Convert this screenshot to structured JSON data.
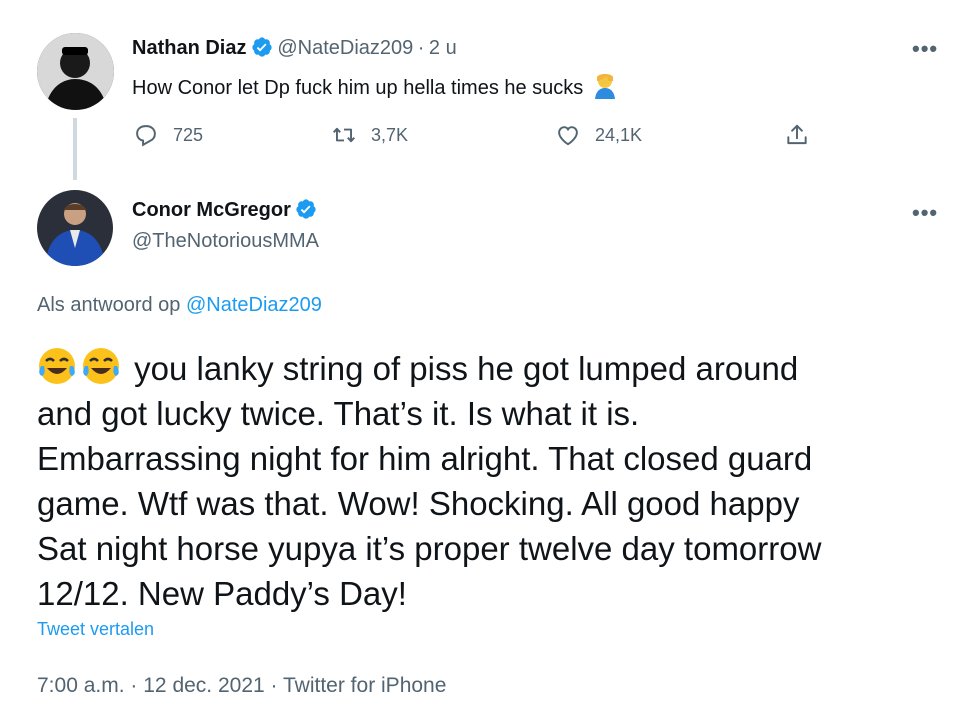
{
  "tweet1": {
    "name": "Nathan Diaz",
    "handle": "@NateDiaz209",
    "separator": "·",
    "time": "2 u",
    "text": "How Conor let Dp fuck him up hella times he sucks",
    "actions": {
      "replies": "725",
      "retweets": "3,7K",
      "likes": "24,1K"
    }
  },
  "tweet2": {
    "name": "Conor McGregor",
    "handle": "@TheNotoriousMMA",
    "reply_prefix": "Als antwoord op",
    "reply_to": "@NateDiaz209",
    "text_lines": [
      "you lanky string of piss he got lumped around",
      "and got lucky twice. That’s it. Is what it is.",
      "Embarrassing night for him alright. That closed guard",
      "game. Wtf was that. Wow! Shocking. All good happy",
      "Sat night horse yupya it’s proper twelve day tomorrow",
      "12/12. New Paddy’s Day!"
    ],
    "translate": "Tweet vertalen",
    "meta": {
      "time": "7:00 a.m.",
      "date": "12 dec. 2021",
      "source": "Twitter for iPhone",
      "dot": "·"
    }
  },
  "colors": {
    "text": "#0f1419",
    "secondary": "#536471",
    "accent": "#1d9bf0",
    "thread_line": "#cfd9de"
  }
}
